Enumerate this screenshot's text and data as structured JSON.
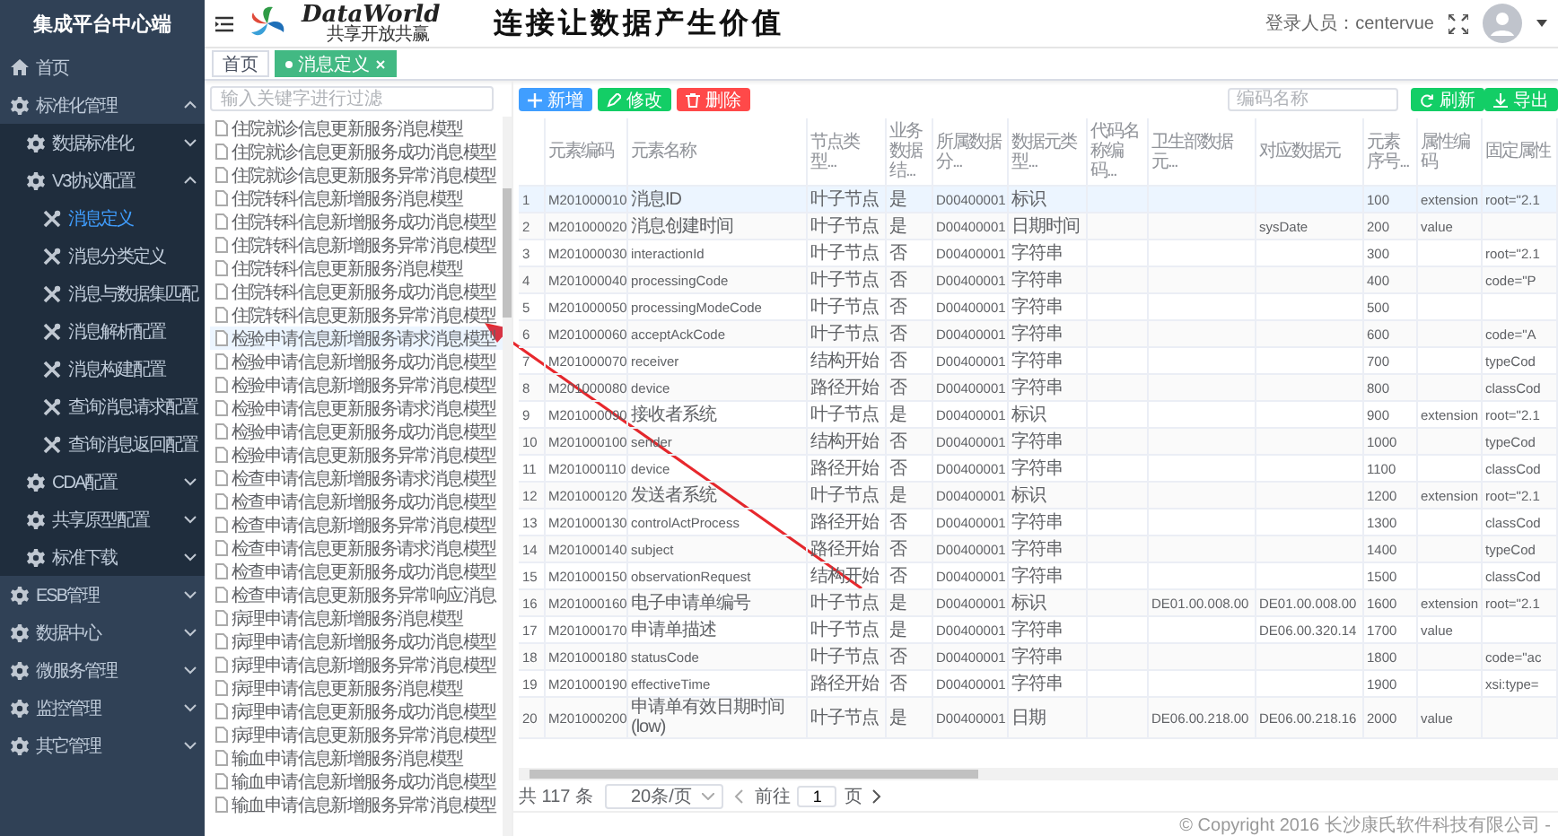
{
  "sidebar": {
    "title": "集成平台中心端",
    "items": [
      {
        "label": "首页",
        "kind": "home"
      },
      {
        "label": "标准化管理",
        "kind": "group",
        "expanded": true,
        "children": [
          {
            "label": "数据标准化",
            "kind": "group",
            "expanded": false
          },
          {
            "label": "V3协议配置",
            "kind": "group",
            "expanded": true,
            "children": [
              {
                "label": "消息定义",
                "kind": "page",
                "selected": true
              },
              {
                "label": "消息分类定义",
                "kind": "page",
                "selected": false
              },
              {
                "label": "消息与数据集匹配",
                "kind": "page",
                "selected": false
              },
              {
                "label": "消息解析配置",
                "kind": "page",
                "selected": false
              },
              {
                "label": "消息构建配置",
                "kind": "page",
                "selected": false
              },
              {
                "label": "查询消息请求配置",
                "kind": "page",
                "selected": false
              },
              {
                "label": "查询消息返回配置",
                "kind": "page",
                "selected": false
              }
            ]
          },
          {
            "label": "CDA配置",
            "kind": "group",
            "expanded": false
          },
          {
            "label": "共享原型配置",
            "kind": "group",
            "expanded": false
          },
          {
            "label": "标准下载",
            "kind": "group",
            "expanded": false
          }
        ]
      },
      {
        "label": "ESB管理",
        "kind": "group",
        "expanded": false
      },
      {
        "label": "数据中心",
        "kind": "group",
        "expanded": false
      },
      {
        "label": "微服务管理",
        "kind": "group",
        "expanded": false
      },
      {
        "label": "监控管理",
        "kind": "group",
        "expanded": false
      },
      {
        "label": "其它管理",
        "kind": "group",
        "expanded": false
      }
    ]
  },
  "header": {
    "logo_text": "DataWorld",
    "logo_tagline": "共享开放共赢",
    "slogan": "连接让数据产生价值",
    "user_label": "登录人员：centervue"
  },
  "tabs": [
    {
      "label": "首页",
      "selected": false,
      "closable": false
    },
    {
      "label": "消息定义",
      "selected": true,
      "closable": true
    }
  ],
  "tree": {
    "placeholder": "输入关键字进行过滤",
    "items": [
      {
        "label": "住院就诊信息更新服务消息模型",
        "selected": false
      },
      {
        "label": "住院就诊信息更新服务成功消息模型",
        "selected": false
      },
      {
        "label": "住院就诊信息更新服务异常消息模型",
        "selected": false
      },
      {
        "label": "住院转科信息新增服务消息模型",
        "selected": false
      },
      {
        "label": "住院转科信息新增服务成功消息模型",
        "selected": false
      },
      {
        "label": "住院转科信息新增服务异常消息模型",
        "selected": false
      },
      {
        "label": "住院转科信息更新服务消息模型",
        "selected": false
      },
      {
        "label": "住院转科信息更新服务成功消息模型",
        "selected": false
      },
      {
        "label": "住院转科信息更新服务异常消息模型",
        "selected": false
      },
      {
        "label": "检验申请信息新增服务请求消息模型",
        "selected": true
      },
      {
        "label": "检验申请信息新增服务成功消息模型",
        "selected": false
      },
      {
        "label": "检验申请信息新增服务异常消息模型",
        "selected": false
      },
      {
        "label": "检验申请信息更新服务请求消息模型",
        "selected": false
      },
      {
        "label": "检验申请信息更新服务成功消息模型",
        "selected": false
      },
      {
        "label": "检验申请信息更新服务异常消息模型",
        "selected": false
      },
      {
        "label": "检查申请信息新增服务请求消息模型",
        "selected": false
      },
      {
        "label": "检查申请信息新增服务成功消息模型",
        "selected": false
      },
      {
        "label": "检查申请信息新增服务异常消息模型",
        "selected": false
      },
      {
        "label": "检查申请信息更新服务请求消息模型",
        "selected": false
      },
      {
        "label": "检查申请信息更新服务成功消息模型",
        "selected": false
      },
      {
        "label": "检查申请信息更新服务异常响应消息",
        "selected": false
      },
      {
        "label": "病理申请信息新增服务消息模型",
        "selected": false
      },
      {
        "label": "病理申请信息新增服务成功消息模型",
        "selected": false
      },
      {
        "label": "病理申请信息新增服务异常消息模型",
        "selected": false
      },
      {
        "label": "病理申请信息更新服务消息模型",
        "selected": false
      },
      {
        "label": "病理申请信息更新服务成功消息模型",
        "selected": false
      },
      {
        "label": "病理申请信息更新服务异常消息模型",
        "selected": false
      },
      {
        "label": "输血申请信息新增服务消息模型",
        "selected": false
      },
      {
        "label": "输血申请信息新增服务成功消息模型",
        "selected": false
      },
      {
        "label": "输血申请信息新增服务异常消息模型",
        "selected": false
      }
    ]
  },
  "toolbar": {
    "actions": [
      {
        "label": "新增",
        "kind": "add"
      },
      {
        "label": "修改",
        "kind": "edit"
      },
      {
        "label": "删除",
        "kind": "delete"
      }
    ],
    "search": {
      "placeholder": "编码名称"
    },
    "tools": [
      {
        "label": "刷新",
        "kind": "refresh"
      },
      {
        "label": "导出",
        "kind": "export"
      }
    ]
  },
  "table": {
    "columns": [
      "元素编码",
      "元素名称",
      "节点类型...",
      "业务数据结...",
      "所属数据分...",
      "数据元类型...",
      "代码名称编码...",
      "卫生部数据元...",
      "对应数据元",
      "元素序号...",
      "属性编码",
      "固定属性"
    ],
    "rows": [
      {
        "index": "1",
        "selected": true,
        "cells": [
          "M201000010",
          "消息ID",
          "叶子节点",
          "是",
          "D00400001",
          "标识",
          null,
          null,
          null,
          "100",
          "extension",
          "root=\"2.1"
        ]
      },
      {
        "index": "2",
        "selected": false,
        "cells": [
          "M201000020",
          "消息创建时间",
          "叶子节点",
          "是",
          "D00400001",
          "日期时间",
          null,
          null,
          "sysDate",
          "200",
          "value",
          null
        ]
      },
      {
        "index": "3",
        "selected": false,
        "cells": [
          "M201000030",
          "interactionId",
          "叶子节点",
          "否",
          "D00400001",
          "字符串",
          null,
          null,
          null,
          "300",
          null,
          "root=\"2.1"
        ]
      },
      {
        "index": "4",
        "selected": false,
        "cells": [
          "M201000040",
          "processingCode",
          "叶子节点",
          "否",
          "D00400001",
          "字符串",
          null,
          null,
          null,
          "400",
          null,
          "code=\"P"
        ]
      },
      {
        "index": "5",
        "selected": false,
        "cells": [
          "M201000050",
          "processingModeCode",
          "叶子节点",
          "否",
          "D00400001",
          "字符串",
          null,
          null,
          null,
          "500",
          null,
          null
        ]
      },
      {
        "index": "6",
        "selected": false,
        "cells": [
          "M201000060",
          "acceptAckCode",
          "叶子节点",
          "否",
          "D00400001",
          "字符串",
          null,
          null,
          null,
          "600",
          null,
          "code=\"A"
        ]
      },
      {
        "index": "7",
        "selected": false,
        "cells": [
          "M201000070",
          "receiver",
          "结构开始",
          "否",
          "D00400001",
          "字符串",
          null,
          null,
          null,
          "700",
          null,
          "typeCod"
        ]
      },
      {
        "index": "8",
        "selected": false,
        "cells": [
          "M201000080",
          "device",
          "路径开始",
          "否",
          "D00400001",
          "字符串",
          null,
          null,
          null,
          "800",
          null,
          "classCod"
        ]
      },
      {
        "index": "9",
        "selected": false,
        "cells": [
          "M201000090",
          "接收者系统",
          "叶子节点",
          "是",
          "D00400001",
          "标识",
          null,
          null,
          null,
          "900",
          "extension",
          "root=\"2.1"
        ]
      },
      {
        "index": "10",
        "selected": false,
        "cells": [
          "M201000100",
          "sender",
          "结构开始",
          "否",
          "D00400001",
          "字符串",
          null,
          null,
          null,
          "1000",
          null,
          "typeCod"
        ]
      },
      {
        "index": "11",
        "selected": false,
        "cells": [
          "M201000110",
          "device",
          "路径开始",
          "否",
          "D00400001",
          "字符串",
          null,
          null,
          null,
          "1100",
          null,
          "classCod"
        ]
      },
      {
        "index": "12",
        "selected": false,
        "cells": [
          "M201000120",
          "发送者系统",
          "叶子节点",
          "是",
          "D00400001",
          "标识",
          null,
          null,
          null,
          "1200",
          "extension",
          "root=\"2.1"
        ]
      },
      {
        "index": "13",
        "selected": false,
        "cells": [
          "M201000130",
          "controlActProcess",
          "路径开始",
          "否",
          "D00400001",
          "字符串",
          null,
          null,
          null,
          "1300",
          null,
          "classCod"
        ]
      },
      {
        "index": "14",
        "selected": false,
        "cells": [
          "M201000140",
          "subject",
          "路径开始",
          "否",
          "D00400001",
          "字符串",
          null,
          null,
          null,
          "1400",
          null,
          "typeCod"
        ]
      },
      {
        "index": "15",
        "selected": false,
        "cells": [
          "M201000150",
          "observationRequest",
          "结构开始",
          "否",
          "D00400001",
          "字符串",
          null,
          null,
          null,
          "1500",
          null,
          "classCod"
        ]
      },
      {
        "index": "16",
        "selected": false,
        "cells": [
          "M201000160",
          "电子申请单编号",
          "叶子节点",
          "是",
          "D00400001",
          "标识",
          null,
          "DE01.00.008.00",
          "DE01.00.008.00",
          "1600",
          "extension",
          "root=\"2.1"
        ]
      },
      {
        "index": "17",
        "selected": false,
        "cells": [
          "M201000170",
          "申请单描述",
          "叶子节点",
          "是",
          "D00400001",
          "字符串",
          null,
          null,
          "DE06.00.320.14",
          "1700",
          "value",
          null
        ]
      },
      {
        "index": "18",
        "selected": false,
        "cells": [
          "M201000180",
          "statusCode",
          "叶子节点",
          "否",
          "D00400001",
          "字符串",
          null,
          null,
          null,
          "1800",
          null,
          "code=\"ac"
        ]
      },
      {
        "index": "19",
        "selected": false,
        "cells": [
          "M201000190",
          "effectiveTime",
          "路径开始",
          "否",
          "D00400001",
          "字符串",
          null,
          null,
          null,
          "1900",
          null,
          "xsi:type="
        ]
      },
      {
        "index": "20",
        "selected": false,
        "cells": [
          "M201000200",
          "申请单有效日期时间(low)",
          "叶子节点",
          "是",
          "D00400001",
          "日期",
          null,
          "DE06.00.218.00",
          "DE06.00.218.16",
          "2000",
          "value",
          null
        ]
      }
    ]
  },
  "pagination": {
    "total": "共 117 条",
    "page_size": "20条/页",
    "goto_label": "前往",
    "page": "1",
    "page_suffix": "页"
  },
  "footer": {
    "copyright": "© Copyright 2016 长沙康氏软件科技有限公司 -"
  }
}
